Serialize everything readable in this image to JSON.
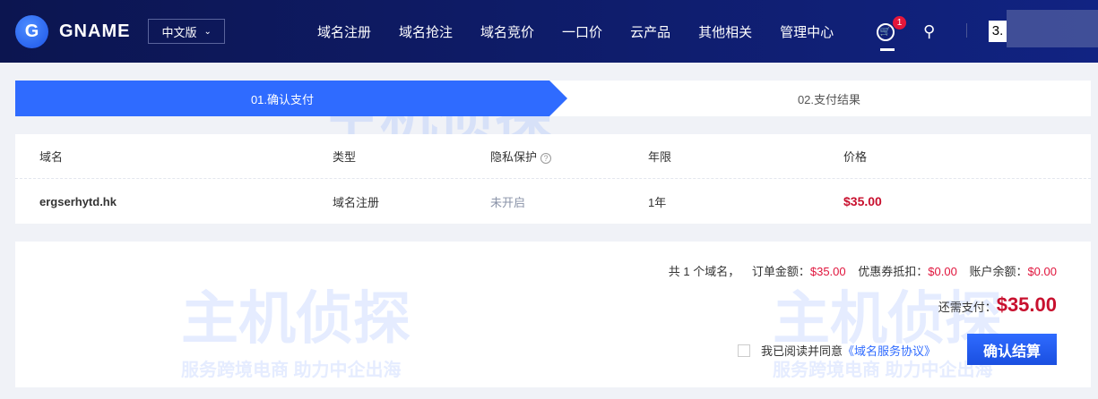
{
  "nav": {
    "logo_mark": "G",
    "brand": "GNAME",
    "lang": "中文版",
    "menu": [
      "域名注册",
      "域名抢注",
      "域名竞价",
      "一口价",
      "云产品",
      "其他相关",
      "管理中心"
    ],
    "cart_badge": "1",
    "user": "3."
  },
  "steps": [
    "01.确认支付",
    "02.支付结果"
  ],
  "table": {
    "headers": [
      "域名",
      "类型",
      "隐私保护",
      "年限",
      "价格"
    ],
    "privacy_help": "?",
    "rows": [
      {
        "domain": "ergserhytd.hk",
        "type": "域名注册",
        "privacy": "未开启",
        "years": "1年",
        "price": "$35.00"
      }
    ]
  },
  "summary": {
    "count_prefix": "共 1 个域名，",
    "order_label": "订单金额：",
    "order_amount": "$35.00",
    "coupon_label": "优惠券抵扣：",
    "coupon_amount": "$0.00",
    "balance_label": "账户余额：",
    "balance_amount": "$0.00",
    "due_label": "还需支付：",
    "due_amount": "$35.00",
    "agree_text": "我已阅读并同意",
    "agreement_link": "《域名服务协议》",
    "confirm": "确认结算"
  },
  "watermark": {
    "title": "主机侦探",
    "slogan": "服务跨境电商 助力中企出海"
  },
  "colors": {
    "accent": "#2f6bff",
    "price": "#c8102e",
    "nav": "#0c1550"
  }
}
